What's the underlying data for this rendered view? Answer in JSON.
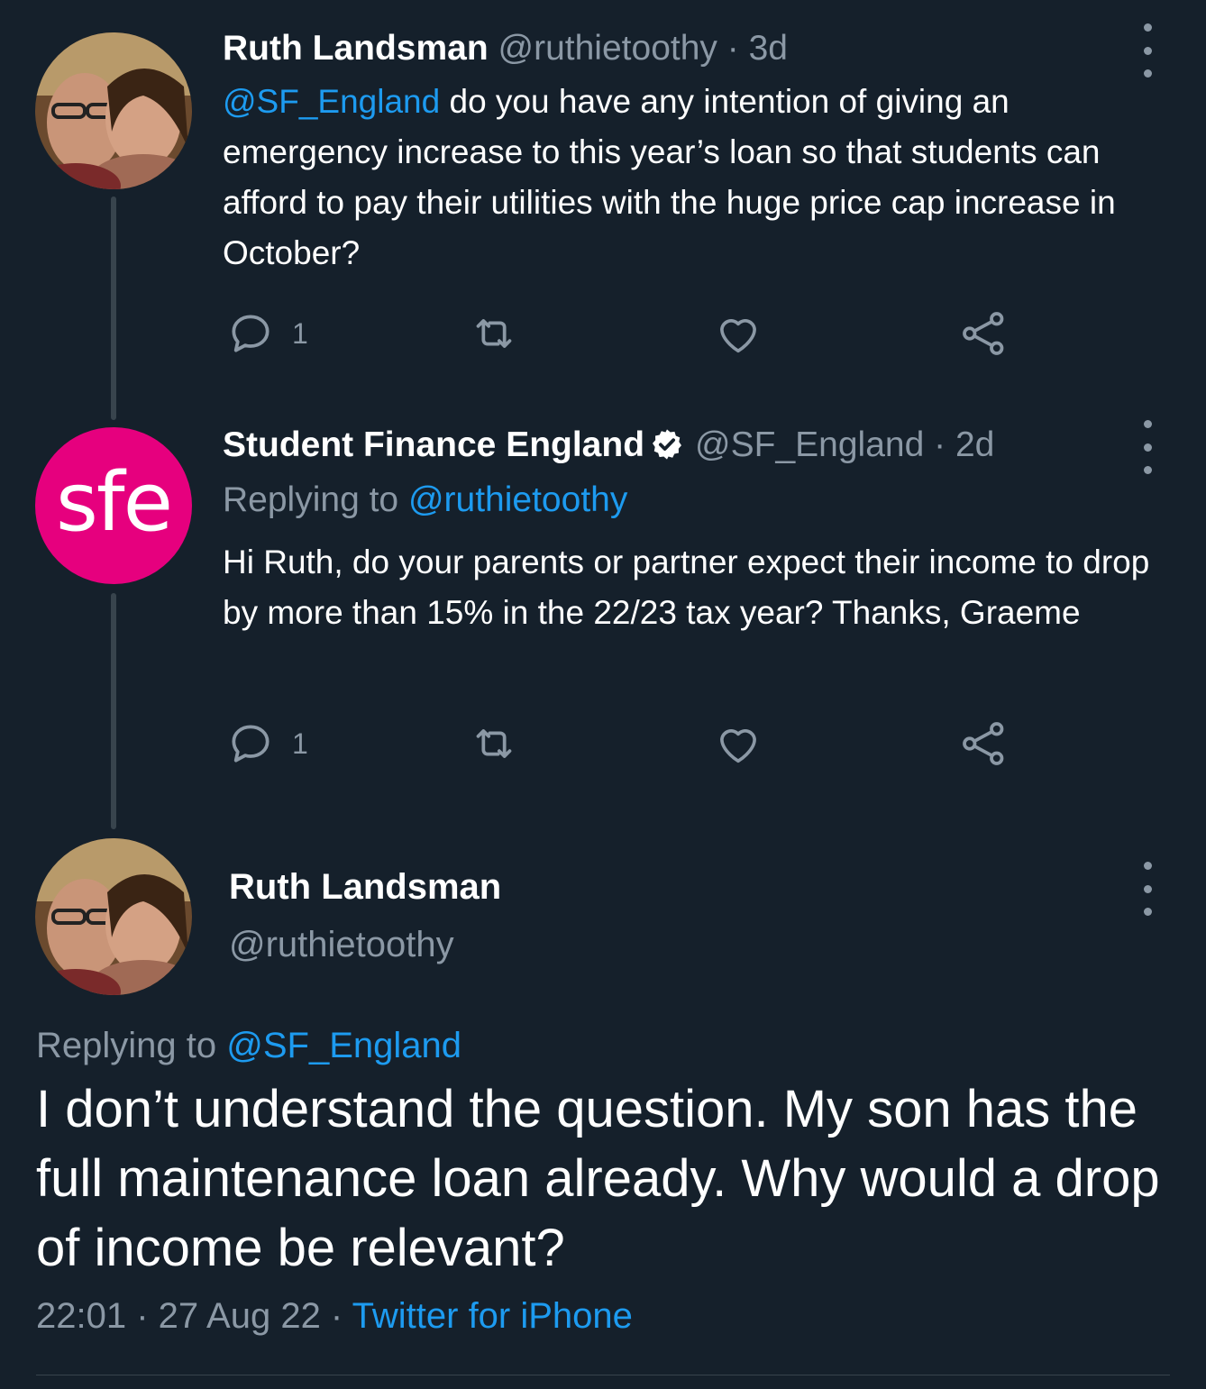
{
  "tweet1": {
    "display_name": "Ruth Landsman",
    "handle": "@ruthietoothy",
    "time": "· 3d",
    "mention": "@SF_England",
    "text": " do you have any intention of giving an emergency increase to this year’s loan so that students can afford to pay their utilities with the huge price cap increase in October?",
    "reply_count": "1",
    "icons": [
      "reply-icon",
      "retweet-icon",
      "like-icon",
      "share-icon"
    ]
  },
  "tweet2": {
    "display_name": "Student Finance England",
    "handle": "@SF_England",
    "time": "· 2d",
    "replying_prefix": "Replying to ",
    "replying_handle": "@ruthietoothy",
    "text": "Hi Ruth, do your parents or partner expect their income to drop by more than 15% in the 22/23 tax year? Thanks, Graeme",
    "reply_count": "1",
    "avatar_text": "sfe",
    "avatar_color": "#e6007e"
  },
  "main_tweet": {
    "display_name": "Ruth Landsman",
    "handle": "@ruthietoothy",
    "replying_prefix": "Replying to ",
    "replying_handle": "@SF_England",
    "text": "I don’t understand the question. My son has the full maintenance loan already. Why would a drop of income be relevant?",
    "time": "22:01 · 27 Aug 22 · ",
    "source": "Twitter for iPhone"
  },
  "colors": {
    "background": "#15202b",
    "link": "#1d9bf0",
    "muted": "#8b98a5",
    "thread_line": "#38444d"
  }
}
